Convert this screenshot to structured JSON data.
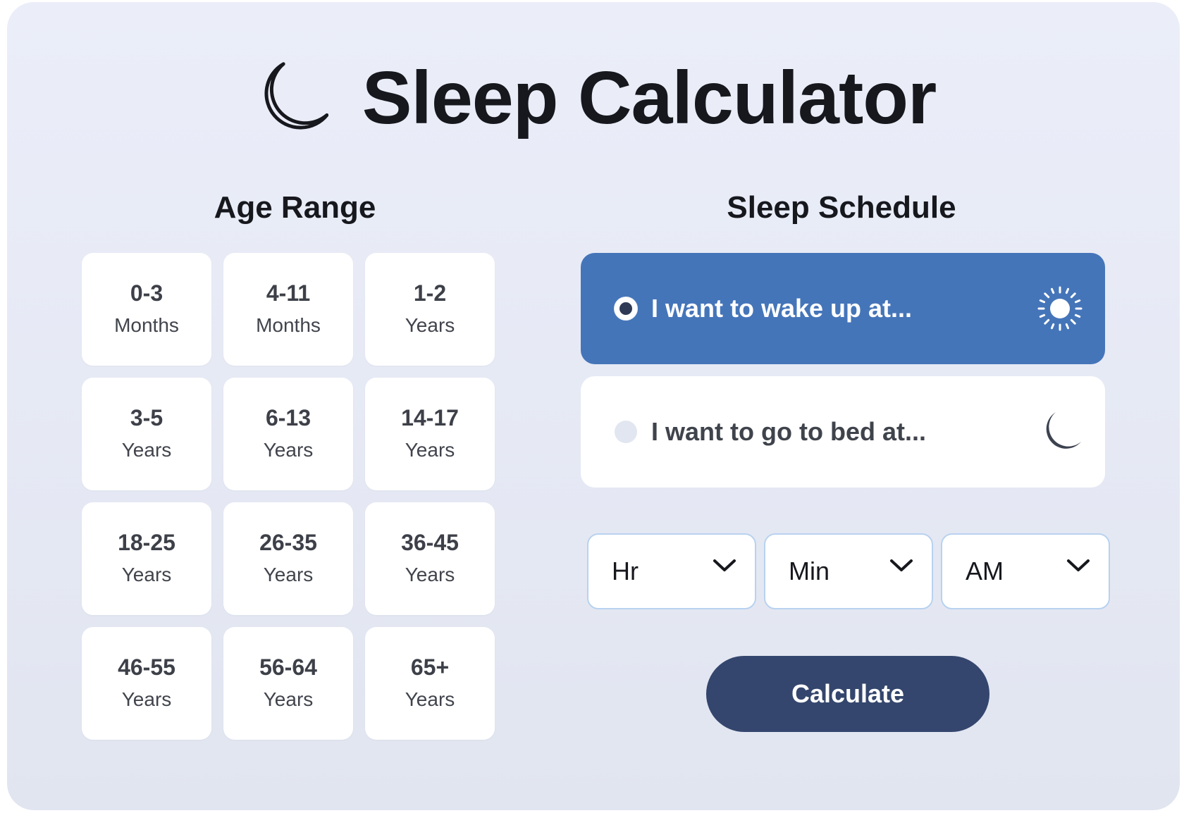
{
  "app": {
    "title": "Sleep Calculator",
    "logo_icon": "moon-outline-icon"
  },
  "age_section": {
    "title": "Age Range",
    "items": [
      {
        "range": "0-3",
        "unit": "Months"
      },
      {
        "range": "4-11",
        "unit": "Months"
      },
      {
        "range": "1-2",
        "unit": "Years"
      },
      {
        "range": "3-5",
        "unit": "Years"
      },
      {
        "range": "6-13",
        "unit": "Years"
      },
      {
        "range": "14-17",
        "unit": "Years"
      },
      {
        "range": "18-25",
        "unit": "Years"
      },
      {
        "range": "26-35",
        "unit": "Years"
      },
      {
        "range": "36-45",
        "unit": "Years"
      },
      {
        "range": "46-55",
        "unit": "Years"
      },
      {
        "range": "56-64",
        "unit": "Years"
      },
      {
        "range": "65+",
        "unit": "Years"
      }
    ]
  },
  "schedule_section": {
    "title": "Sleep Schedule",
    "options": [
      {
        "label": "I want to wake up at...",
        "icon": "sun-icon",
        "selected": true
      },
      {
        "label": "I want to go to bed at...",
        "icon": "moon-icon",
        "selected": false
      }
    ],
    "time_selects": {
      "hour": "Hr",
      "minute": "Min",
      "period": "AM"
    },
    "calculate_label": "Calculate"
  },
  "colors": {
    "card_background": "#ebeef9",
    "selected_option": "#4575b9",
    "button": "#34466d",
    "select_border": "#b8d2ef"
  }
}
